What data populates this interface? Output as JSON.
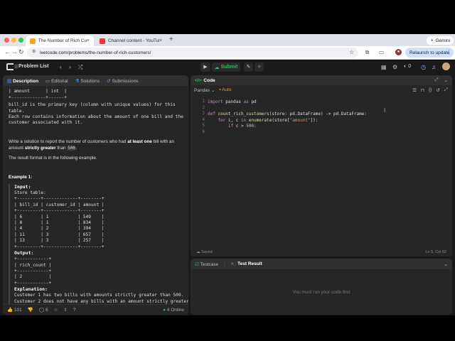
{
  "browser": {
    "tabs": [
      {
        "title": "The Number of Rich Custome…",
        "icon_color": "#f5a623"
      },
      {
        "title": "Channel content - YouTube S…",
        "icon_color": "#e33"
      }
    ],
    "gemini_label": "Gemini",
    "url": "leetcode.com/problems/the-number-of-rich-customers/",
    "relaunch_label": "Relaunch to update"
  },
  "lc_top": {
    "problem_list": "Problem List",
    "submit": "Submit",
    "streak": "0"
  },
  "left_tabs": [
    "Description",
    "Editorial",
    "Solutions",
    "Submissions"
  ],
  "desc": {
    "table_top": "+-------------+------+\n| amount      | int  |\n+-------------+------+",
    "schema_text": "bill_id is the primary key (column with unique values) for this\ntable.\nEach row contains information about the amount of one bill and the\ncustomer associated with it.",
    "task_pre": "Write a solution to report the number of customers who had ",
    "task_bold1": "at least one",
    "task_mid": " bill with an amount ",
    "task_bold2": "strictly greater",
    "task_post": " than ",
    "task_code": "500",
    "task_end": ".",
    "format": "The result format is in the following example.",
    "example_title": "Example 1:",
    "input_label": "Input:",
    "store_table": "Store table:\n+---------+-------------+--------+\n| bill_id | customer_id | amount |\n+---------+-------------+--------+\n| 6       | 1           | 549    |\n| 8       | 1           | 834    |\n| 4       | 2           | 394    |\n| 11      | 3           | 657    |\n| 13      | 3           | 257    |\n+---------+-------------+--------+",
    "output_label": "Output:",
    "output_table": "+------------+\n| rich_count |\n+------------+\n| 2          |\n+------------+",
    "explanation_label": "Explanation:",
    "explanation": "Customer 1 has two bills with amounts strictly greater than 500.\nCustomer 2 does not have any bills with an amount strictly greater"
  },
  "left_foot": {
    "likes": "101",
    "comments": "6",
    "online": "4 Online"
  },
  "code": {
    "title": "Code",
    "language": "Pandas",
    "auto": "Auto",
    "saved": "Saved",
    "cursor": "Ln 5, Col 62",
    "lines": [
      "1",
      "2",
      "3",
      "4",
      "5",
      "6"
    ]
  },
  "test": {
    "tabs": [
      "Testcase",
      "Test Result"
    ],
    "message": "You must run your code first"
  }
}
